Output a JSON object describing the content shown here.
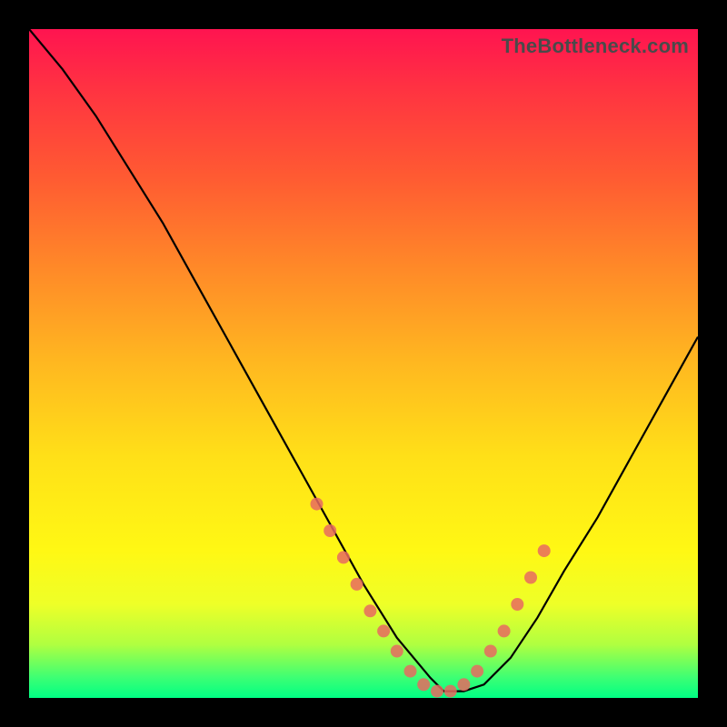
{
  "watermark": "TheBottleneck.com",
  "chart_data": {
    "type": "line",
    "title": "",
    "xlabel": "",
    "ylabel": "",
    "xlim": [
      0,
      100
    ],
    "ylim": [
      0,
      100
    ],
    "grid": false,
    "series": [
      {
        "name": "bottleneck-curve",
        "x": [
          0,
          5,
          10,
          15,
          20,
          25,
          30,
          35,
          40,
          45,
          50,
          55,
          60,
          62,
          65,
          68,
          72,
          76,
          80,
          85,
          90,
          95,
          100
        ],
        "values": [
          100,
          94,
          87,
          79,
          71,
          62,
          53,
          44,
          35,
          26,
          17,
          9,
          3,
          1,
          1,
          2,
          6,
          12,
          19,
          27,
          36,
          45,
          54
        ]
      }
    ],
    "scatter": {
      "name": "highlight-points",
      "points": [
        {
          "x": 43,
          "y": 29
        },
        {
          "x": 45,
          "y": 25
        },
        {
          "x": 47,
          "y": 21
        },
        {
          "x": 49,
          "y": 17
        },
        {
          "x": 51,
          "y": 13
        },
        {
          "x": 53,
          "y": 10
        },
        {
          "x": 55,
          "y": 7
        },
        {
          "x": 57,
          "y": 4
        },
        {
          "x": 59,
          "y": 2
        },
        {
          "x": 61,
          "y": 1
        },
        {
          "x": 63,
          "y": 1
        },
        {
          "x": 65,
          "y": 2
        },
        {
          "x": 67,
          "y": 4
        },
        {
          "x": 69,
          "y": 7
        },
        {
          "x": 71,
          "y": 10
        },
        {
          "x": 73,
          "y": 14
        },
        {
          "x": 75,
          "y": 18
        },
        {
          "x": 77,
          "y": 22
        }
      ]
    },
    "background_gradient": {
      "top": "#ff1450",
      "bottom": "#00ff84"
    }
  }
}
